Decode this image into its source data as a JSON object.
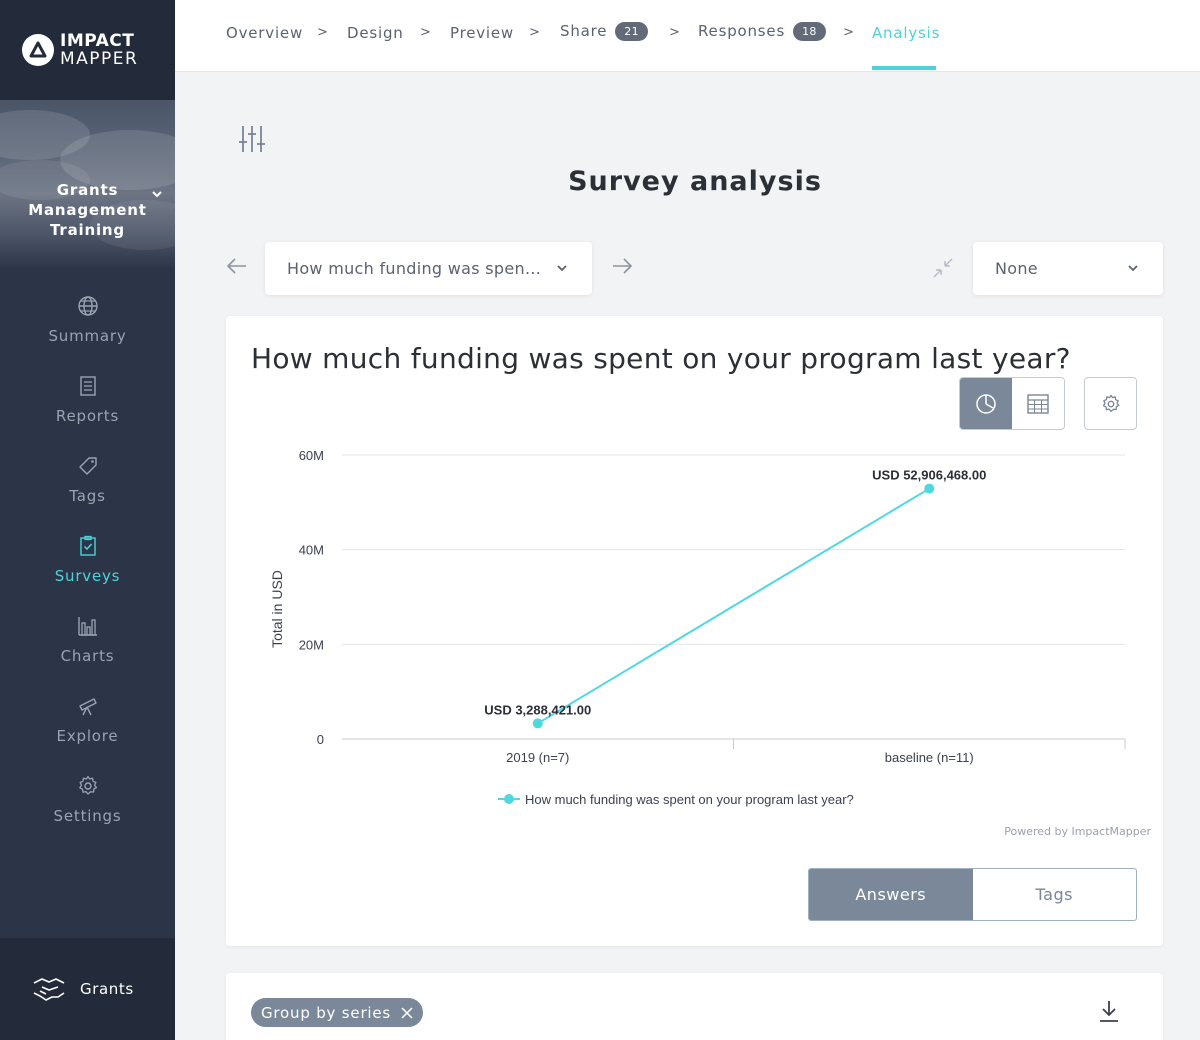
{
  "logo": {
    "line1": "IMPACT",
    "line2": "MAPPER"
  },
  "sidebar": {
    "org_name": "Grants Management Training",
    "items": [
      {
        "label": "Summary",
        "icon": "globe-icon"
      },
      {
        "label": "Reports",
        "icon": "document-icon"
      },
      {
        "label": "Tags",
        "icon": "tag-icon"
      },
      {
        "label": "Surveys",
        "icon": "clipboard-check-icon",
        "active": true
      },
      {
        "label": "Charts",
        "icon": "bar-chart-icon"
      },
      {
        "label": "Explore",
        "icon": "telescope-icon"
      },
      {
        "label": "Settings",
        "icon": "gear-icon"
      }
    ],
    "grants_label": "Grants"
  },
  "breadcrumb": {
    "steps": [
      {
        "label": "Overview"
      },
      {
        "label": "Design"
      },
      {
        "label": "Preview"
      },
      {
        "label": "Share",
        "badge": "21"
      },
      {
        "label": "Responses",
        "badge": "18"
      },
      {
        "label": "Analysis",
        "active": true
      }
    ],
    "separator": ">"
  },
  "main": {
    "title": "Survey analysis",
    "question_select": "How much funding was spen…",
    "compare_select": "None"
  },
  "chart_card": {
    "title": "How much funding was spent on your program last year?",
    "powered_by": "Powered by ImpactMapper",
    "segments": {
      "answers": "Answers",
      "tags": "Tags"
    }
  },
  "chart_data": {
    "type": "line",
    "x": [
      "2019 (n=7)",
      "baseline (n=11)"
    ],
    "series": [
      {
        "name": "How much funding was spent on your program last year?",
        "values": [
          3288421.0,
          52906468.0
        ],
        "color": "#4fd9de"
      }
    ],
    "data_labels": [
      "USD 3,288,421.00",
      "USD 52,906,468.00"
    ],
    "ylabel": "Total in USD",
    "yticks": [
      "0",
      "20M",
      "40M",
      "60M"
    ],
    "ylim": [
      0,
      60000000
    ],
    "grid": true,
    "legend": "bottom"
  },
  "grouping": {
    "chip_label": "Group by series"
  },
  "colors": {
    "sidebar": "#2c3547",
    "accent": "#4fd1d9",
    "button_active": "#7a8899"
  }
}
